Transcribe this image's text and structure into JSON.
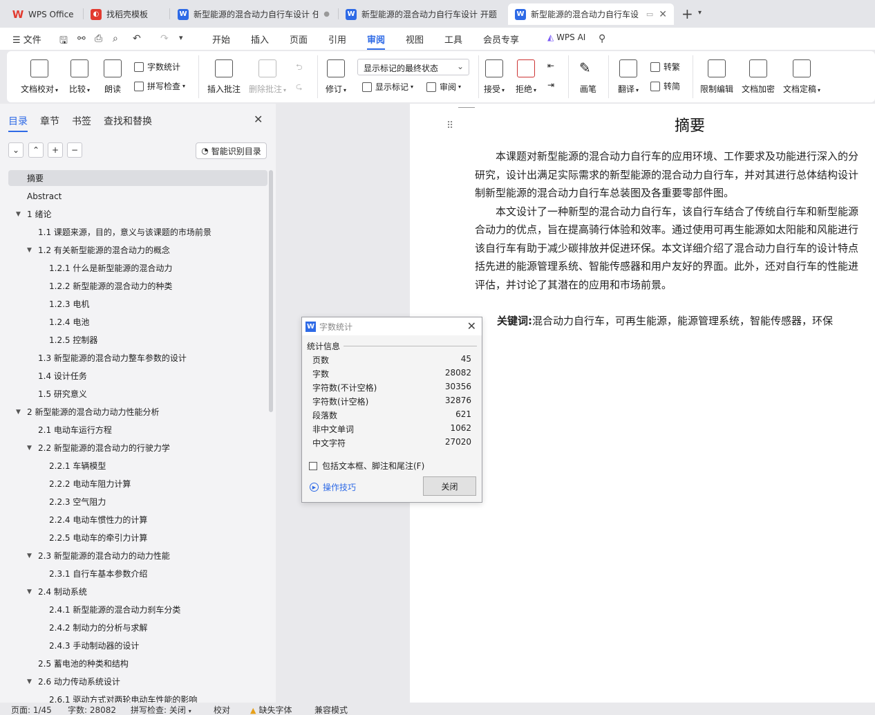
{
  "tabs": [
    {
      "label": "WPS Office",
      "icon": "wps-logo-icon"
    },
    {
      "label": "找稻壳模板",
      "icon": "docer-icon"
    },
    {
      "label": "新型能源的混合动力自行车设计 任",
      "icon": "word-doc-icon"
    },
    {
      "label": "新型能源的混合动力自行车设计 开题",
      "icon": "word-doc-icon"
    },
    {
      "label": "新型能源的混合动力自行车设",
      "icon": "word-doc-icon"
    }
  ],
  "menu": {
    "file": "文件",
    "items": [
      "开始",
      "插入",
      "页面",
      "引用",
      "审阅",
      "视图",
      "工具",
      "会员专享"
    ],
    "active": "审阅",
    "ai": "WPS AI"
  },
  "ribbon": {
    "doc_check": "文档校对",
    "compare": "比较",
    "read_aloud": "朗读",
    "word_count": "字数统计",
    "spell_check": "拼写检查",
    "insert_comment": "插入批注",
    "delete_comment": "删除批注",
    "revise": "修订",
    "markup_select": "显示标记的最终状态",
    "show_markup": "显示标记",
    "review": "审阅",
    "accept": "接受",
    "reject": "拒绝",
    "pen": "画笔",
    "translate": "翻译",
    "to_traditional": "转繁",
    "to_simplified": "转简",
    "restrict_edit": "限制编辑",
    "encrypt": "文档加密",
    "finalize": "文档定稿"
  },
  "nav": {
    "tabs": [
      "目录",
      "章节",
      "书签",
      "查找和替换"
    ],
    "smart_toc": "智能识别目录",
    "toc": [
      {
        "label": "摘要",
        "level": 0,
        "selected": true
      },
      {
        "label": "Abstract",
        "level": 0
      },
      {
        "label": "1   绪论",
        "level": 0,
        "expand": true
      },
      {
        "label": "1.1  课题来源，目的，意义与该课题的市场前景",
        "level": 1
      },
      {
        "label": "1.2  有关新型能源的混合动力的概念",
        "level": 1,
        "expand": true
      },
      {
        "label": "1.2.1  什么是新型能源的混合动力",
        "level": 2
      },
      {
        "label": "1.2.2  新型能源的混合动力的种类",
        "level": 2
      },
      {
        "label": "1.2.3  电机",
        "level": 2
      },
      {
        "label": "1.2.4  电池",
        "level": 2
      },
      {
        "label": "1.2.5  控制器",
        "level": 2
      },
      {
        "label": "1.3  新型能源的混合动力整车参数的设计",
        "level": 1
      },
      {
        "label": "1.4  设计任务",
        "level": 1
      },
      {
        "label": "1.5  研究意义",
        "level": 1
      },
      {
        "label": "2  新型能源的混合动力动力性能分析",
        "level": 0,
        "expand": true
      },
      {
        "label": "2.1  电动车运行方程",
        "level": 1
      },
      {
        "label": "2.2  新型能源的混合动力的行驶力学",
        "level": 1,
        "expand": true
      },
      {
        "label": "2.2.1  车辆模型",
        "level": 2
      },
      {
        "label": "2.2.2  电动车阻力计算",
        "level": 2
      },
      {
        "label": "2.2.3  空气阻力",
        "level": 2
      },
      {
        "label": "2.2.4  电动车惯性力的计算",
        "level": 2
      },
      {
        "label": "2.2.5  电动车的牵引力计算",
        "level": 2
      },
      {
        "label": "2.3  新型能源的混合动力的动力性能",
        "level": 1,
        "expand": true
      },
      {
        "label": "2.3.1  自行车基本参数介绍",
        "level": 2
      },
      {
        "label": "2.4  制动系统",
        "level": 1,
        "expand": true
      },
      {
        "label": "2.4.1  新型能源的混合动力刹车分类",
        "level": 2
      },
      {
        "label": "2.4.2  制动力的分析与求解",
        "level": 2
      },
      {
        "label": "2.4.3  手动制动器的设计",
        "level": 2
      },
      {
        "label": "2.5  蓄电池的种类和结构",
        "level": 1
      },
      {
        "label": "2.6  动力传动系统设计",
        "level": 1,
        "expand": true
      },
      {
        "label": "2.6.1  驱动方式对两轮电动车性能的影响",
        "level": 2
      }
    ]
  },
  "document": {
    "title": "摘要",
    "lines": [
      "本课题对新型能源的混合动力自行车的应用环境、工作要求及功能进行深入的分",
      "研究，设计出满足实际需求的新型能源的混合动力自行车，并对其进行总体结构设计",
      "制新型能源的混合动力自行车总装图及各重要零部件图。",
      "本文设计了一种新型的混合动力自行车，该自行车结合了传统自行车和新型能源",
      "合动力的优点，旨在提高骑行体验和效率。通过使用可再生能源如太阳能和风能进行",
      "该自行车有助于减少碳排放并促进环保。本文详细介绍了混合动力自行车的设计特点",
      "括先进的能源管理系统、智能传感器和用户友好的界面。此外，还对自行车的性能进",
      "评估，并讨论了其潜在的应用和市场前景。"
    ],
    "keywords_label": "关键词:",
    "keywords": "混合动力自行车，可再生能源，能源管理系统，智能传感器，环保"
  },
  "dialog": {
    "title": "字数统计",
    "group": "统计信息",
    "stats": [
      {
        "label": "页数",
        "value": "45"
      },
      {
        "label": "字数",
        "value": "28082"
      },
      {
        "label": "字符数(不计空格)",
        "value": "30356"
      },
      {
        "label": "字符数(计空格)",
        "value": "32876"
      },
      {
        "label": "段落数",
        "value": "621"
      },
      {
        "label": "非中文单词",
        "value": "1062"
      },
      {
        "label": "中文字符",
        "value": "27020"
      }
    ],
    "include_label": "包括文本框、脚注和尾注(F)",
    "tips": "操作技巧",
    "close": "关闭"
  },
  "status": {
    "page": "页面: 1/45",
    "words": "字数: 28082",
    "spell": "拼写检查: 关闭",
    "proof": "校对",
    "missing_font": "缺失字体",
    "compat": "兼容模式"
  },
  "colors": {
    "accent": "#2e6ae6",
    "wps_red": "#e23b30"
  }
}
